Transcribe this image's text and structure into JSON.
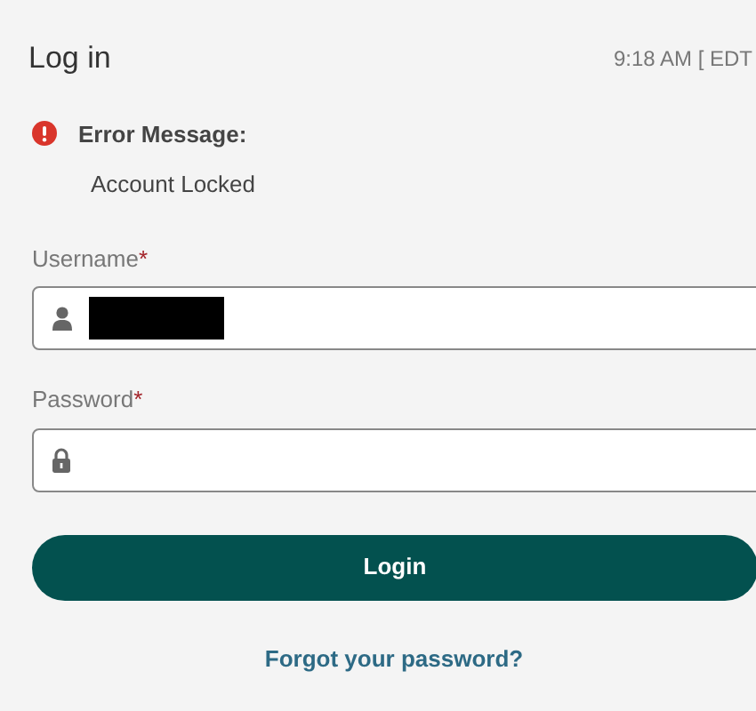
{
  "header": {
    "title": "Log in",
    "time": "9:18 AM [ EDT"
  },
  "error": {
    "heading": "Error Message:",
    "message": "Account Locked"
  },
  "fields": [
    {
      "label": "Username",
      "required_mark": "*",
      "kind": "user",
      "redacted": true
    },
    {
      "label": "Password",
      "required_mark": "*",
      "kind": "password",
      "redacted": false
    }
  ],
  "login_button": "Login",
  "forgot_link": "Forgot your password?"
}
